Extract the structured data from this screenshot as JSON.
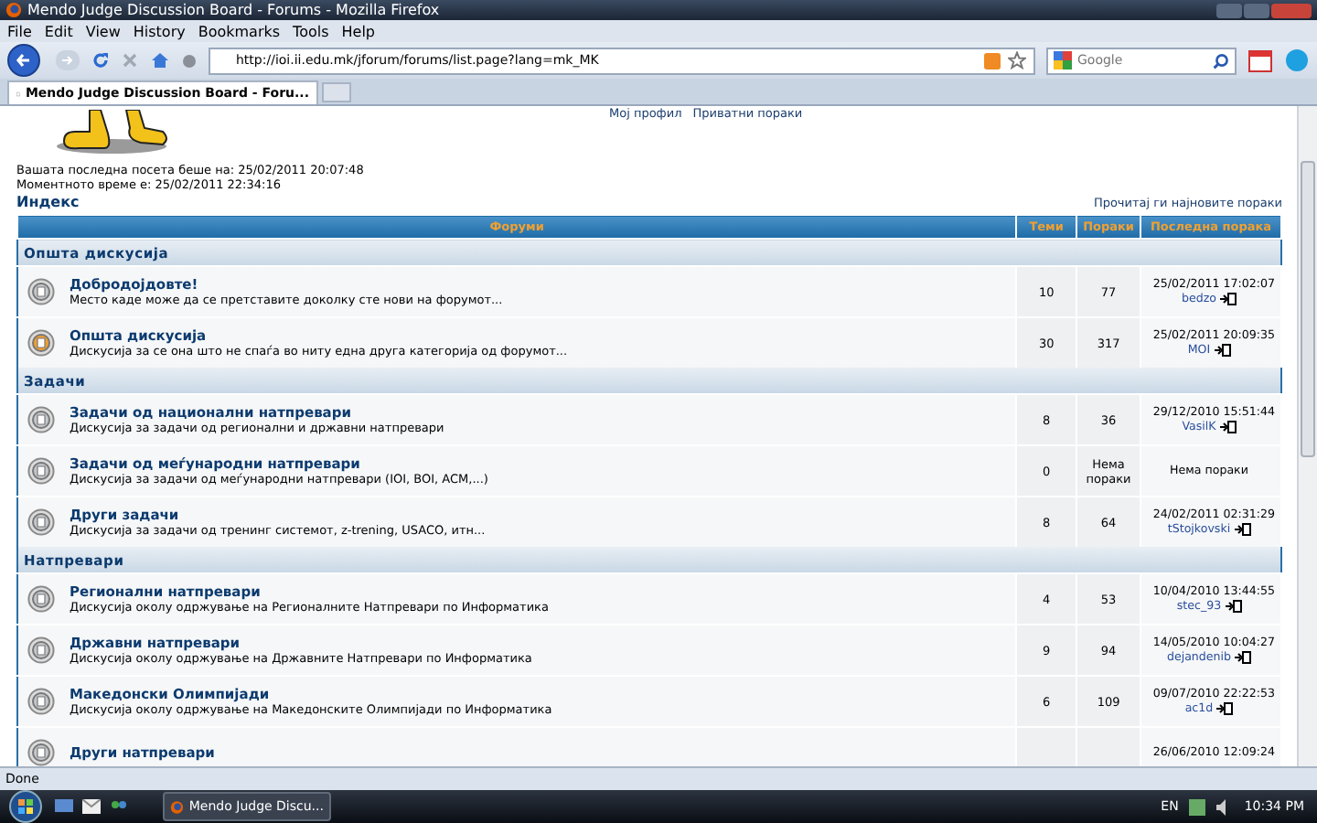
{
  "window": {
    "title": "Mendo Judge Discussion Board - Forums - Mozilla Firefox"
  },
  "menu": [
    "File",
    "Edit",
    "View",
    "History",
    "Bookmarks",
    "Tools",
    "Help"
  ],
  "toolbar": {
    "url": "http://ioi.ii.edu.mk/jforum/forums/list.page?lang=mk_MK",
    "search_placeholder": "Google"
  },
  "tabs": [
    {
      "label": "Mendo Judge Discussion Board - Foru...",
      "selected": true
    }
  ],
  "page": {
    "header_links": [
      "Мој профил",
      "Приватни пораки"
    ],
    "last_visit": "Вашата последна посета беше на: 25/02/2011 20:07:48",
    "current_time": "Моментното време е: 25/02/2011 22:34:16",
    "breadcrumb": "Индекс",
    "latest_link": "Прочитај ги најновите пораки"
  },
  "table": {
    "columns": [
      "Форуми",
      "Теми",
      "Пораки",
      "Последна порака"
    ],
    "sections": [
      {
        "name": "Општа дискусија",
        "forums": [
          {
            "title": "Добродојдовте!",
            "description": "Место каде може да се претставите доколку сте нови на форумот...",
            "topics": "10",
            "posts": "77",
            "last_post": {
              "date": "25/02/2011 17:02:07",
              "user": "bedzo"
            },
            "unread": false
          },
          {
            "title": "Општа дискусија",
            "description": "Дискусија за се она што не спаѓа во ниту една друга категорија од форумот...",
            "topics": "30",
            "posts": "317",
            "last_post": {
              "date": "25/02/2011 20:09:35",
              "user": "MOI"
            },
            "unread": true
          }
        ]
      },
      {
        "name": "Задачи",
        "forums": [
          {
            "title": "Задачи од национални натпревари",
            "description": "Дискусија за задачи од регионални и државни натпревари",
            "topics": "8",
            "posts": "36",
            "last_post": {
              "date": "29/12/2010 15:51:44",
              "user": "VasilK"
            },
            "unread": false
          },
          {
            "title": "Задачи од меѓународни натпревари",
            "description": "Дискусија за задачи од меѓународни натпревари (IOI, BOI, ACM,...)",
            "topics": "0",
            "posts": "Нема пораки",
            "last_post": {
              "text": "Нема пораки"
            },
            "unread": false
          },
          {
            "title": "Други задачи",
            "description": "Дискусија за задачи од тренинг системот, z-trening, USACO, итн...",
            "topics": "8",
            "posts": "64",
            "last_post": {
              "date": "24/02/2011 02:31:29",
              "user": "tStojkovski"
            },
            "unread": false
          }
        ]
      },
      {
        "name": "Натпревари",
        "forums": [
          {
            "title": "Регионални натпревари",
            "description": "Дискусија околу одржување на Регионалните Натпревари по Информатика",
            "topics": "4",
            "posts": "53",
            "last_post": {
              "date": "10/04/2010 13:44:55",
              "user": "stec_93"
            },
            "unread": false
          },
          {
            "title": "Државни натпревари",
            "description": "Дискусија околу одржување на Државните Натпревари по Информатика",
            "topics": "9",
            "posts": "94",
            "last_post": {
              "date": "14/05/2010 10:04:27",
              "user": "dejandenib"
            },
            "unread": false
          },
          {
            "title": "Македонски Олимпијади",
            "description": "Дискусија околу одржување на Македонските Олимпијади по Информатика",
            "topics": "6",
            "posts": "109",
            "last_post": {
              "date": "09/07/2010 22:22:53",
              "user": "ac1d"
            },
            "unread": false
          },
          {
            "title": "Други натпревари",
            "last_post": {
              "date": "26/06/2010 12:09:24"
            },
            "unread": false
          }
        ]
      }
    ]
  },
  "status_bar": "Done",
  "taskbar": {
    "task": "Mendo Judge Discu...",
    "language": "EN",
    "time": "10:34 PM"
  }
}
